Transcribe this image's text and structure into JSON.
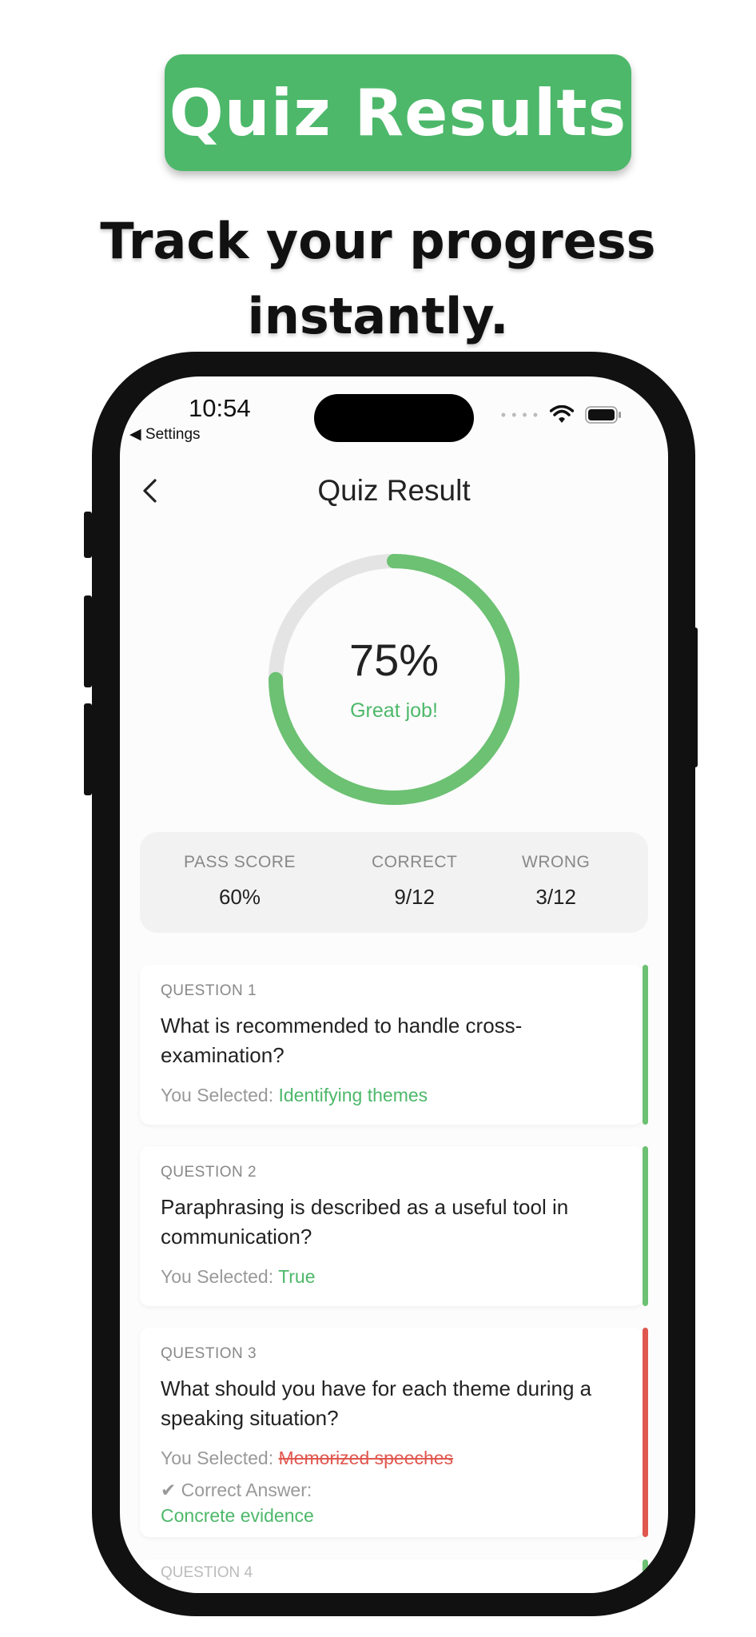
{
  "promo": {
    "banner_title": "Quiz Results",
    "tagline_line1": "Track your progress",
    "tagline_line2": "instantly."
  },
  "status_bar": {
    "time": "10:54",
    "back_app": "◀ Settings"
  },
  "nav": {
    "title": "Quiz Result"
  },
  "score": {
    "percent_label": "75%",
    "percent_value": 0.75,
    "message": "Great job!"
  },
  "stats": {
    "pass_label": "PASS SCORE",
    "pass_value": "60%",
    "correct_label": "CORRECT",
    "correct_value": "9/12",
    "wrong_label": "WRONG",
    "wrong_value": "3/12"
  },
  "questions": [
    {
      "label": "QUESTION 1",
      "text": "What is recommended to handle cross-examination?",
      "selected_prefix": "You Selected: ",
      "selected": "Identifying themes",
      "status": "correct"
    },
    {
      "label": "QUESTION 2",
      "text": "Paraphrasing is described as a useful tool in communication?",
      "selected_prefix": "You Selected: ",
      "selected": "True",
      "status": "correct"
    },
    {
      "label": "QUESTION 3",
      "text": "What should you have for each theme during a speaking situation?",
      "selected_prefix": "You Selected: ",
      "selected": "Memorized speeches",
      "status": "wrong",
      "correct_prefix": "✔  Correct Answer:",
      "correct_answer": "Concrete evidence"
    },
    {
      "label": "QUESTION 4"
    }
  ],
  "colors": {
    "brand_green": "#4db86a",
    "wrong_red": "#e0574f"
  }
}
